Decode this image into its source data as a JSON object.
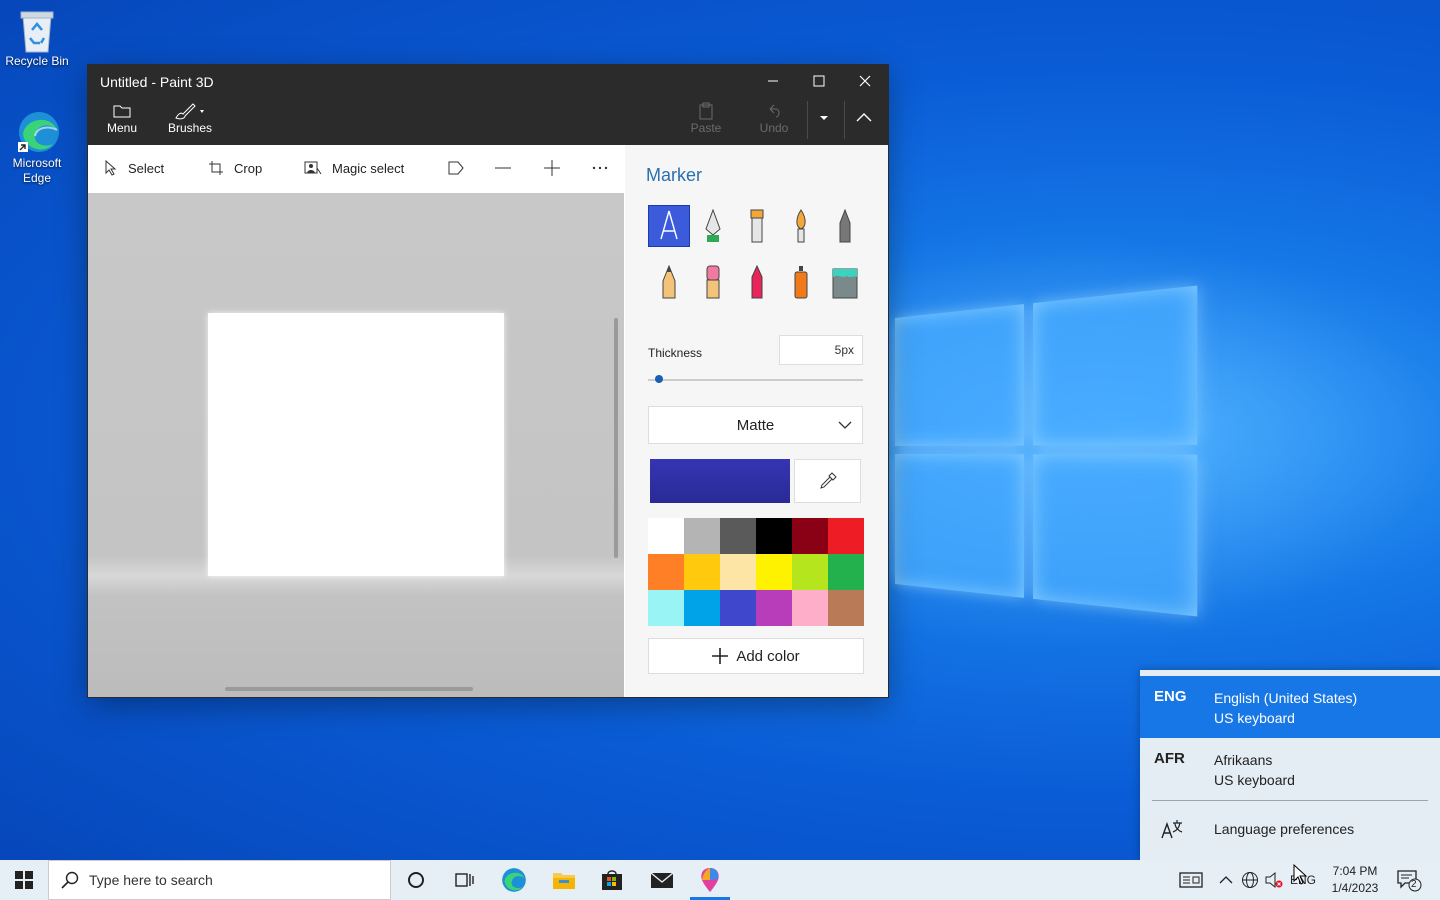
{
  "desktop": {
    "icons": [
      {
        "label": "Recycle Bin"
      },
      {
        "label": "Microsoft Edge"
      }
    ]
  },
  "paint": {
    "title": "Untitled - Paint 3D",
    "toolbar": {
      "menu_label": "Menu",
      "brushes_label": "Brushes",
      "paste_label": "Paste",
      "undo_label": "Undo"
    },
    "tools": {
      "select_label": "Select",
      "crop_label": "Crop",
      "magic_select_label": "Magic select"
    },
    "panel": {
      "heading": "Marker",
      "thickness_label": "Thickness",
      "thickness_value": "5px",
      "thickness_fraction": 0.05,
      "finish_value": "Matte",
      "current_color": "#3535b4",
      "palette": [
        "#ffffff",
        "#b4b4b4",
        "#5a5a5a",
        "#000000",
        "#8a0014",
        "#ee1c24",
        "#ff7f27",
        "#ffc90e",
        "#fde6a5",
        "#fff200",
        "#b5e61d",
        "#22b14c",
        "#99f5f5",
        "#00a2e8",
        "#3f48cc",
        "#b83dba",
        "#ffaec9",
        "#b97a57"
      ],
      "add_color_label": "Add color"
    }
  },
  "language_flyout": {
    "languages": [
      {
        "code": "ENG",
        "name": "English (United States)",
        "keyboard": "US keyboard",
        "active": true
      },
      {
        "code": "AFR",
        "name": "Afrikaans",
        "keyboard": "US keyboard",
        "active": false
      }
    ],
    "preferences_label": "Language preferences"
  },
  "taskbar": {
    "search_placeholder": "Type here to search",
    "lang_indicator": "ENG",
    "time": "7:04 PM",
    "date": "1/4/2023",
    "notification_count": "2"
  },
  "colors": {
    "accent": "#1877e6",
    "titlebar": "#2b2b2b",
    "marker_selected": "#3b5bdb"
  }
}
